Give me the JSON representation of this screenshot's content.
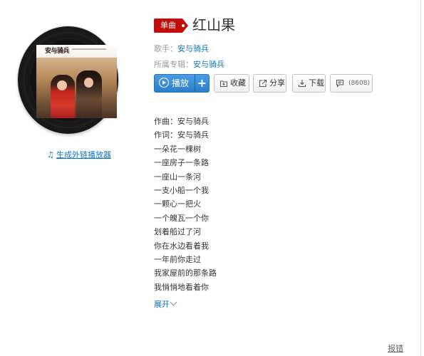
{
  "song": {
    "type_badge": "单曲",
    "title": "红山果"
  },
  "cover": {
    "artist_text": "安与骑兵"
  },
  "meta": {
    "singer_label": "歌手：",
    "singer_name": "安与骑兵",
    "album_label": "所属专辑：",
    "album_name": "安与骑兵"
  },
  "actions": {
    "play_label": "播放",
    "add_label": "+",
    "collect_label": "收藏",
    "share_label": "分享",
    "download_label": "下载",
    "comment_count": "(8608)"
  },
  "lyrics": [
    "作曲：安与骑兵",
    "作词：安与骑兵",
    "一朵花一棵树",
    "一座房子一条路",
    "一座山一条河",
    "一支小船一个我",
    "一颗心一把火",
    "一个魄瓦一个你",
    "划着船过了河",
    "你在水边看着我",
    "一年前你走过",
    "我家屋前的那条路",
    "我悄悄地看着你"
  ],
  "expand_label": "展开",
  "gen_player_link": "生成外链播放器",
  "report_label": "报错",
  "icons": {
    "play": "play-circle-icon",
    "collect": "collect-icon",
    "share": "share-icon",
    "download": "download-icon",
    "comment": "comment-icon",
    "note": "music-note-icon",
    "expand": "chevron-down-icon"
  },
  "colors": {
    "brand_red": "#c20c0c",
    "link_blue": "#0c73c2",
    "play_blue": "#2b7fcc",
    "muted_text": "#999999"
  }
}
